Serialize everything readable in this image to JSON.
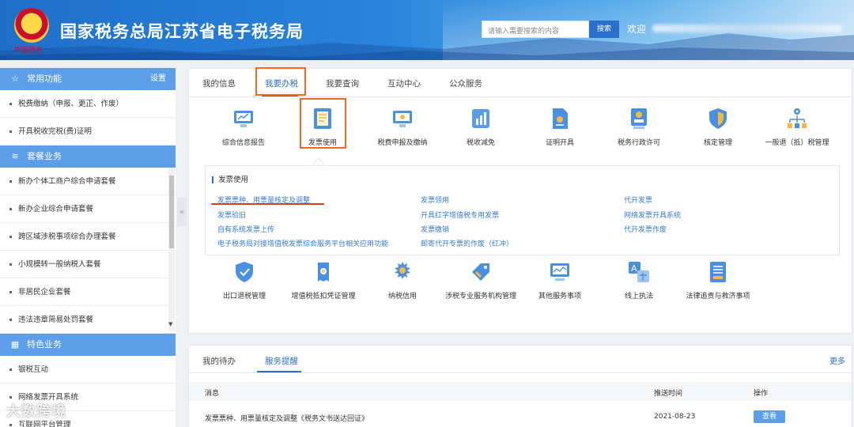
{
  "header": {
    "title": "国家税务总局江苏省电子税务局",
    "logo_sub": "中国税务",
    "search_placeholder": "请输入需要搜索的内容",
    "search_button": "搜索",
    "welcome": "欢迎"
  },
  "sidebar": {
    "common": {
      "title": "常用功能",
      "setting": "设置",
      "items": [
        "税费缴纳（申报、更正、作废）",
        "开具税收完税(费)证明"
      ]
    },
    "packages": {
      "title": "套餐业务",
      "items": [
        "新办个体工商户综合申请套餐",
        "新办企业综合申请套餐",
        "跨区域涉税事项综合办理套餐",
        "小规模转一般纳税人套餐",
        "非居民企业套餐",
        "违法违章简易处罚套餐"
      ]
    },
    "special": {
      "title": "特色业务",
      "items": [
        "银税互动",
        "网络发票开具系统",
        "互联网平台管理"
      ]
    }
  },
  "tabs": [
    "我的信息",
    "我要办税",
    "我要查询",
    "互动中心",
    "公众服务"
  ],
  "services_row1": [
    "综合信息报告",
    "发票使用",
    "税费申报及缴纳",
    "税收减免",
    "证明开具",
    "税务行政许可",
    "核定管理",
    "一般退（抵）税管理"
  ],
  "subpanel": {
    "title": "发票使用",
    "col1": [
      "发票票种、用票量核定及调整",
      "发票验旧",
      "自有系统发票上传",
      "电子税务局对接增值税发票综合服务平台相关应用功能"
    ],
    "col2": [
      "发票领用",
      "开具红字增值税专用发票",
      "发票缴销",
      "邮寄代开专票的作废（红冲）"
    ],
    "col3": [
      "代开发票",
      "网络发票开具系统",
      "代开发票作废"
    ]
  },
  "services_row2": [
    "出口退税管理",
    "增值税抵扣凭证管理",
    "纳税信用",
    "涉税专业服务机构管理",
    "其他服务事项",
    "线上执法",
    "法律追责与救济事项"
  ],
  "bottom": {
    "tabs": [
      "我的待办",
      "服务提醒"
    ],
    "more": "更多",
    "headers": [
      "消息",
      "推送时间",
      "操作"
    ],
    "rows": [
      {
        "message": "发票票种、用票量核定及调整《税务文书送达回证》",
        "time": "2021-08-23",
        "action": "查看"
      }
    ]
  },
  "watermark": "大数跨境",
  "colors": {
    "accent": "#2b6fc2",
    "highlight": "#f06a24",
    "sidebar_head": "#5c9fe8",
    "underline_red": "#d83b1f"
  }
}
